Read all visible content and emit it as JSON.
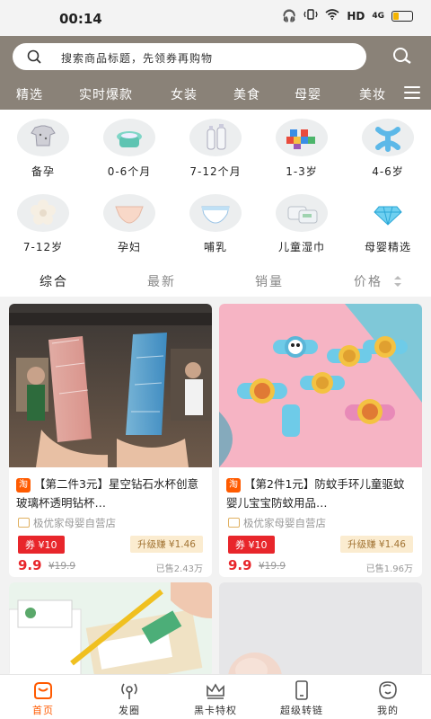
{
  "status_bar": {
    "time": "00:14",
    "network": "HD",
    "signal": "4G"
  },
  "search": {
    "placeholder": "搜索商品标题，先领券再购物"
  },
  "top_tabs": [
    "精选",
    "实时爆款",
    "女装",
    "美食",
    "母婴",
    "美妆"
  ],
  "categories": [
    {
      "label": "备孕",
      "icon": "onesie-icon"
    },
    {
      "label": "0-6个月",
      "icon": "potty-icon"
    },
    {
      "label": "7-12个月",
      "icon": "baby-bottle-icon"
    },
    {
      "label": "1-3岁",
      "icon": "building-blocks-icon"
    },
    {
      "label": "4-6岁",
      "icon": "toy-icon"
    },
    {
      "label": "7-12岁",
      "icon": "flower-mat-icon"
    },
    {
      "label": "孕妇",
      "icon": "maternity-underwear-icon"
    },
    {
      "label": "哺乳",
      "icon": "diaper-icon"
    },
    {
      "label": "儿童湿巾",
      "icon": "wet-wipes-icon"
    },
    {
      "label": "母婴精选",
      "icon": "diamond-icon"
    }
  ],
  "sort_options": [
    "综合",
    "最新",
    "销量",
    "价格"
  ],
  "products": [
    {
      "tag": "淘",
      "title": "【第二件3元】星空钻石水杯创意玻璃杯透明钻杯…",
      "shop": "极优家母婴自营店",
      "coupon": "券 ¥10",
      "upgrade": "升级赚 ¥1.46",
      "price": "9.9",
      "original_price": "¥19.9",
      "sold": "已售2.43万"
    },
    {
      "tag": "淘",
      "title": "【第2件1元】防蚊手环儿童驱蚊婴儿宝宝防蚊用品…",
      "shop": "极优家母婴自营店",
      "coupon": "券 ¥10",
      "upgrade": "升级赚 ¥1.46",
      "price": "9.9",
      "original_price": "¥19.9",
      "sold": "已售1.96万"
    }
  ],
  "bottom_nav": [
    {
      "label": "首页",
      "icon": "home-icon",
      "active": true
    },
    {
      "label": "发圈",
      "icon": "broadcast-icon",
      "active": false
    },
    {
      "label": "黑卡特权",
      "icon": "crown-icon",
      "active": false
    },
    {
      "label": "超级转链",
      "icon": "phone-icon",
      "active": false
    },
    {
      "label": "我的",
      "icon": "profile-face-icon",
      "active": false
    }
  ],
  "colors": {
    "header": "#8a8278",
    "accent": "#ff5a00",
    "coupon": "#e8262b",
    "upgrade_bg": "#fbecd0"
  }
}
